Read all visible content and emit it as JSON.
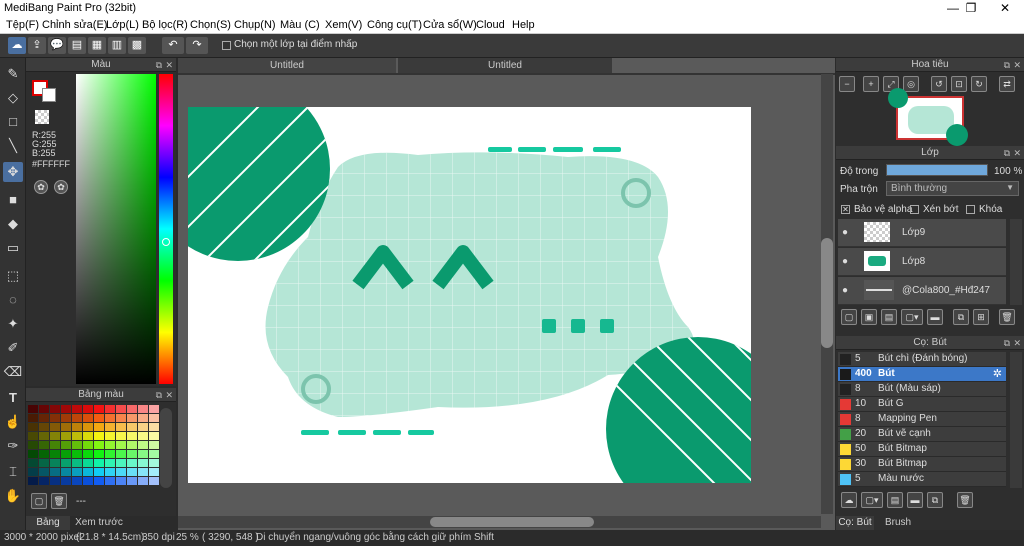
{
  "window": {
    "title": "MediBang Paint Pro (32bit)",
    "minimize": "—",
    "maximize": "❐",
    "close": "✕"
  },
  "menu": [
    "Tệp(F)",
    "Chỉnh sửa(E)",
    "Lớp(L)",
    "Bộ lọc(R)",
    "Chọn(S)",
    "Chụp(N)",
    "Màu (C)",
    "Xem(V)",
    "Công cụ(T)",
    "Cửa sổ(W)",
    "Cloud",
    "Help"
  ],
  "toolbar": {
    "checkbox_label": "Chọn một lớp tại điểm nhấp"
  },
  "color_panel": {
    "title": "Màu",
    "r": "R:255",
    "g": "G:255",
    "b": "B:255",
    "hex": "#FFFFFF"
  },
  "palette_panel": {
    "title": "Bảng màu",
    "name_value": "---"
  },
  "bottom_tabs": [
    "Bảng màu",
    "Xem trước cọ"
  ],
  "document_tabs": [
    "Untitled",
    "Untitled"
  ],
  "navigator": {
    "title": "Hoa tiêu"
  },
  "layers": {
    "title": "Lớp",
    "opacity_label": "Độ trong",
    "opacity_value": "100 %",
    "opacity": 1.0,
    "blend_label": "Pha trộn",
    "blend_value": "Bình thường",
    "protect_alpha": "Bảo vệ alpha",
    "clip": "Xén bớt",
    "lock": "Khóa",
    "items": [
      {
        "name": "Lớp9"
      },
      {
        "name": "Lớp8"
      },
      {
        "name": "@Cola800_#Hđ247"
      }
    ]
  },
  "brush_panel": {
    "title": "Cọ: Bút",
    "items": [
      {
        "size": "5",
        "name": "Bút chì (Đánh bóng)",
        "color": "#222222"
      },
      {
        "size": "400",
        "name": "Bút",
        "color": "#1a1a1a"
      },
      {
        "size": "8",
        "name": "Bút (Màu sáp)",
        "color": "#222222"
      },
      {
        "size": "10",
        "name": "Bút G",
        "color": "#e53935"
      },
      {
        "size": "8",
        "name": "Mapping Pen",
        "color": "#e53935"
      },
      {
        "size": "20",
        "name": "Bút vẽ cạnh",
        "color": "#43a047"
      },
      {
        "size": "50",
        "name": "Bút Bitmap",
        "color": "#fdd835"
      },
      {
        "size": "30",
        "name": "Bút Bitmap",
        "color": "#fdd835"
      },
      {
        "size": "5",
        "name": "Màu nước",
        "color": "#4fc3f7"
      }
    ],
    "selected_index": 1
  },
  "right_tabs": [
    "Cọ: Bút",
    "Brush Size"
  ],
  "status": {
    "size": "3000 * 2000 pixel",
    "cm": "(21.8 * 14.5cm)",
    "dpi": "350 dpi",
    "zoom": "25 %",
    "coords": "( 3290, 548 )",
    "hint": "Di chuyển ngang/vuông góc bằng cách giữ phím Shift"
  },
  "colors": {
    "accent": "#3c78c8",
    "canvas_green": "#0a9a6e",
    "canvas_mint": "#b5e6d6",
    "teal": "#16c9a0"
  }
}
